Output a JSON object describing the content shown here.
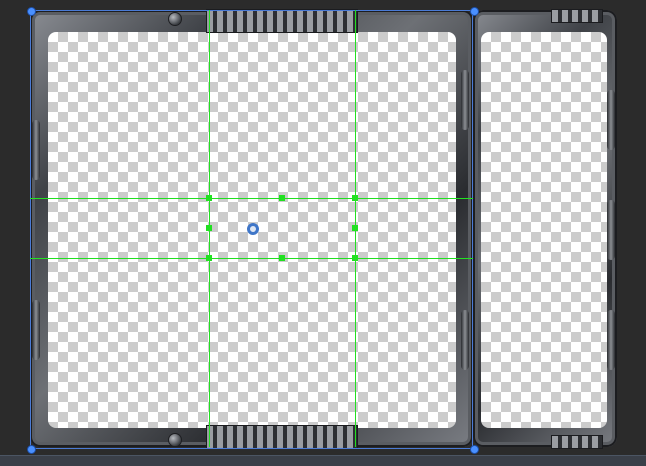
{
  "editor": {
    "background_color": "#2b2b2b",
    "guide_color": "#22e022",
    "selection_color": "#4a7bd6"
  },
  "sprite_frames": [
    {
      "id": "frame-left",
      "style": "metal"
    },
    {
      "id": "frame-right",
      "style": "metal"
    }
  ],
  "icons": {
    "pivot": "pivot-icon",
    "handle": "resize-handle-icon",
    "guide_handle": "slice-handle-icon"
  }
}
